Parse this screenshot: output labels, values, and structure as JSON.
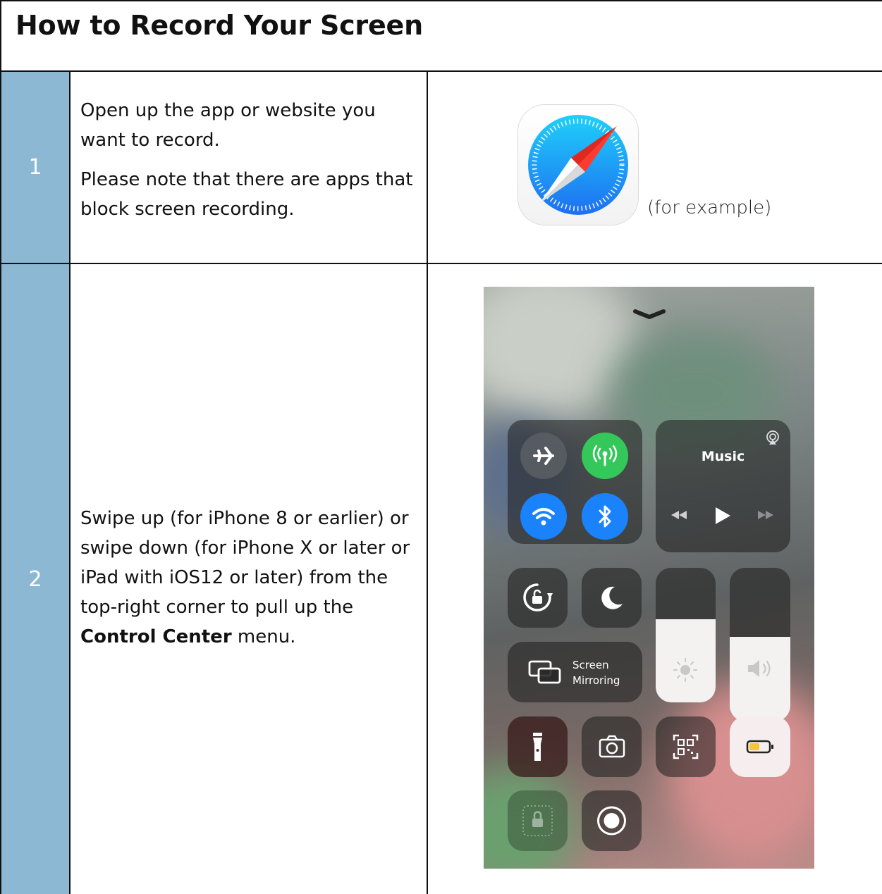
{
  "title": "How to Record Your Screen",
  "steps": [
    {
      "number": "1",
      "paragraphs": [
        "Open up the app or website you want to record.",
        "Please note that there are apps that block screen recording."
      ],
      "image_caption": "(for example)"
    },
    {
      "number": "2",
      "text_before": "Swipe up (for iPhone 8 or earlier) or swipe down (for iPhone X or later or iPad with iOS12 or later) from the top-right corner to pull up the ",
      "text_bold": "Control Center",
      "text_after": " menu."
    }
  ],
  "control_center": {
    "music_label": "Music",
    "screen_mirroring_line1": "Screen",
    "screen_mirroring_line2": "Mirroring"
  },
  "colors": {
    "step_number_bg": "#8db8d4",
    "cellular_green": "#34c759",
    "wifi_blue": "#1a82fb",
    "battery_yellow": "#f5c542"
  },
  "icons": [
    "safari-icon",
    "chevron-down-icon",
    "airplane-icon",
    "cellular-icon",
    "wifi-icon",
    "bluetooth-icon",
    "airplay-icon",
    "rewind-icon",
    "play-icon",
    "fast-forward-icon",
    "orientation-lock-icon",
    "moon-icon",
    "screen-mirroring-icon",
    "brightness-icon",
    "volume-icon",
    "flashlight-icon",
    "camera-icon",
    "qr-code-icon",
    "battery-icon",
    "guided-access-icon",
    "screen-record-icon"
  ]
}
